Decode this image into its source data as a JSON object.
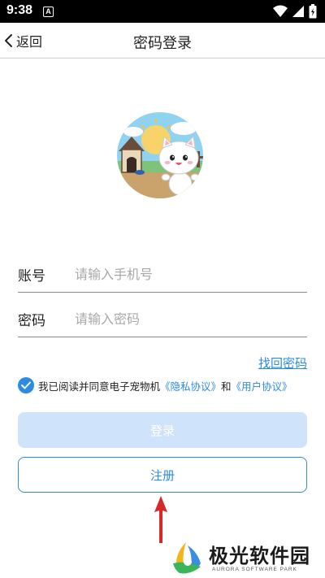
{
  "status_bar": {
    "time": "9:38",
    "notification_badge": "A"
  },
  "nav": {
    "back_label": "返回",
    "title": "密码登录"
  },
  "form": {
    "account_label": "账号",
    "account_placeholder": "请输入手机号",
    "password_label": "密码",
    "password_placeholder": "请输入密码"
  },
  "forgot_password": "找回密码",
  "agreement": {
    "checked": true,
    "prefix": "我已阅读并同意电子宠物机",
    "privacy_link": "《隐私协议》",
    "conjunction": "和",
    "user_link": "《用户协议》"
  },
  "buttons": {
    "login": "登录",
    "register": "注册"
  },
  "watermark": {
    "title": "极光软件园",
    "subtitle": "AURORA SOFTWARE PARK"
  },
  "colors": {
    "accent": "#2d8be0",
    "login_disabled": "#cfe3fa",
    "arrow": "#d62a2a"
  }
}
